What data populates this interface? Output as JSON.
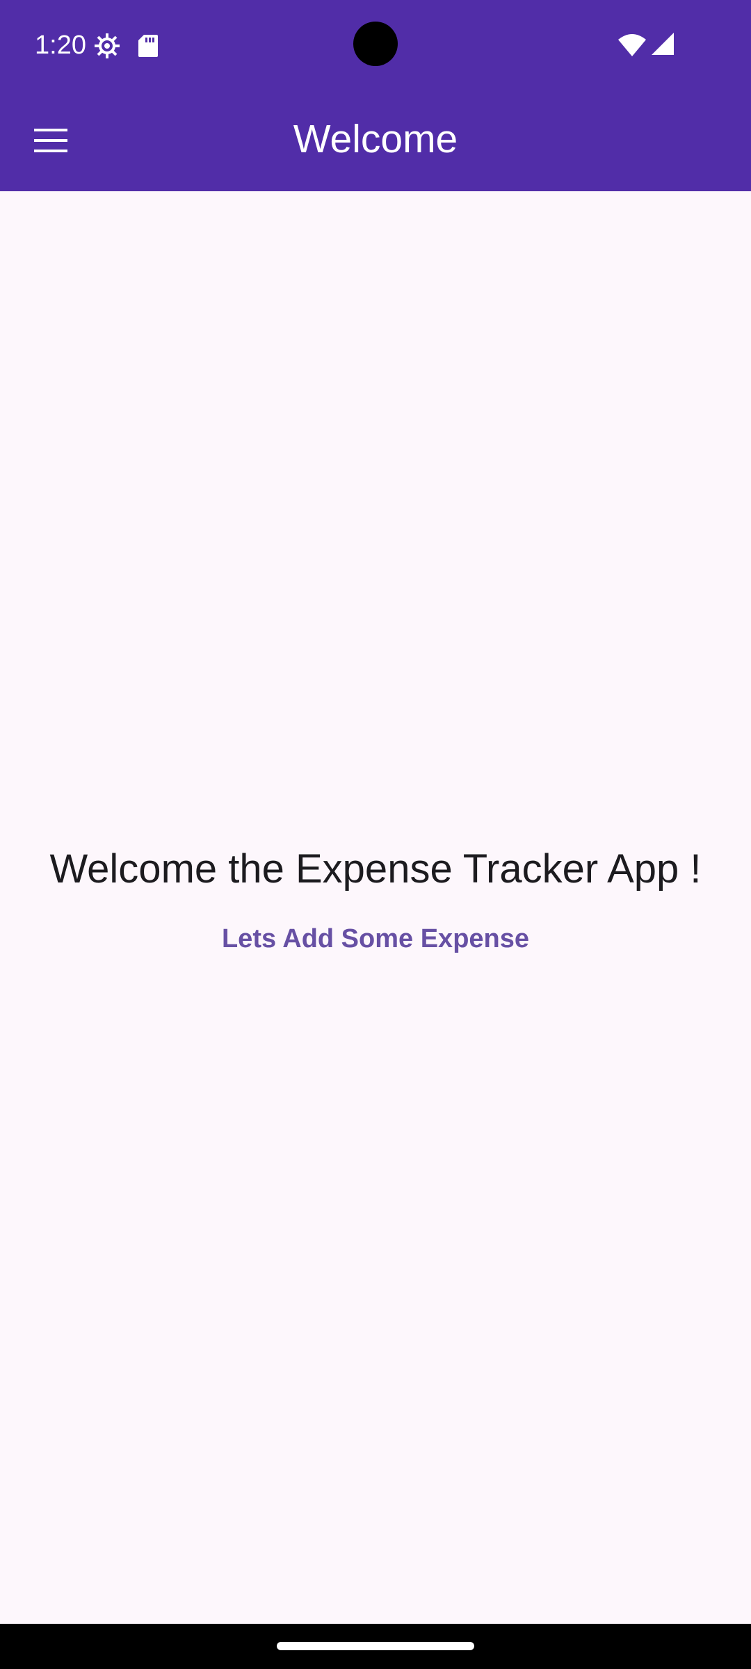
{
  "status_bar": {
    "time": "1:20",
    "icons": [
      "settings-icon",
      "sd-card-icon",
      "wifi-icon",
      "cellular-signal-icon"
    ]
  },
  "app_bar": {
    "title": "Welcome",
    "menu_icon": "hamburger-menu-icon",
    "background_color": "#512da8"
  },
  "main": {
    "welcome_message": "Welcome the Expense Tracker App !",
    "add_expense_label": "Lets Add Some Expense",
    "accent_color": "#6750a4"
  }
}
